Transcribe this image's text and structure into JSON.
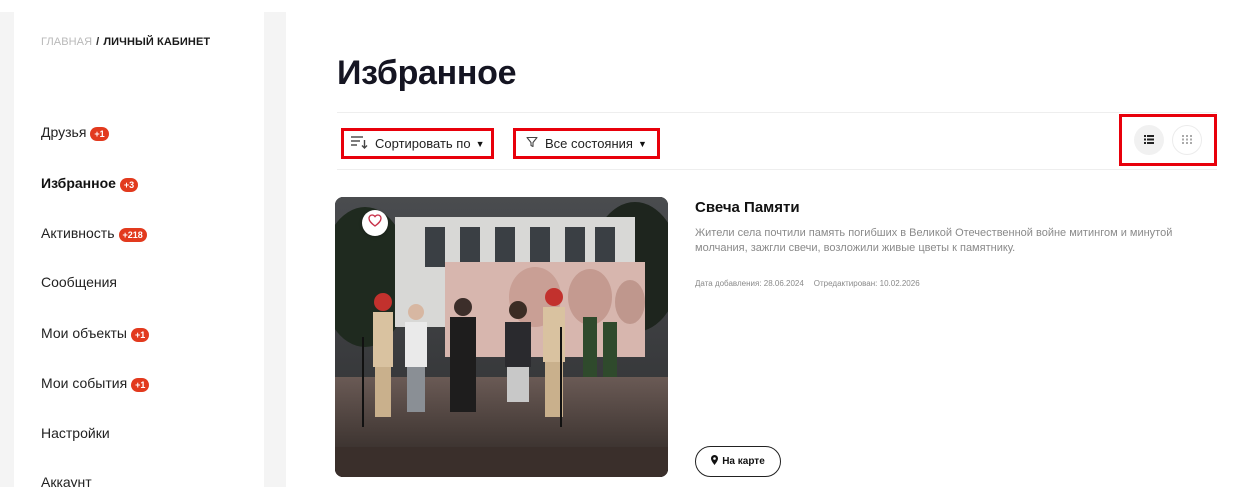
{
  "breadcrumb": {
    "home": "ГЛАВНАЯ",
    "separator": "/",
    "current": "ЛИЧНЫЙ КАБИНЕТ"
  },
  "sidebar": {
    "items": [
      {
        "label": "Друзья",
        "badge": "+1"
      },
      {
        "label": "Избранное",
        "badge": "+3",
        "active": true
      },
      {
        "label": "Активность",
        "badge": "+218"
      },
      {
        "label": "Сообщения",
        "badge": ""
      },
      {
        "label": "Мои объекты",
        "badge": "+1"
      },
      {
        "label": "Мои события",
        "badge": "+1"
      },
      {
        "label": "Настройки",
        "badge": ""
      },
      {
        "label": "Аккаунт",
        "badge": ""
      }
    ]
  },
  "page": {
    "title": "Избранное"
  },
  "toolbar": {
    "sort_label": "Сортировать по",
    "filter_label": "Все состояния",
    "view_mode": "list"
  },
  "card": {
    "title": "Свеча Памяти",
    "description": "Жители села почтили память погибших в Великой Отечественной войне митингом и минутой молчания, зажгли свечи, возложили живые цветы к памятнику.",
    "date_added": "Дата добавления: 28.06.2024",
    "date_edited": "Отредактирован: 10.02.2026",
    "map_button": "На карте"
  },
  "colors": {
    "badge": "#e23a1e",
    "highlight_box": "#e8000b",
    "title": "#151522",
    "muted_text": "#8a8a8a"
  },
  "icons": {
    "sort": "sort-icon",
    "filter": "filter-icon",
    "list_view": "list-view-icon",
    "grid_view": "grid-view-icon",
    "favorite": "heart-icon",
    "map_pin": "map-pin-icon"
  }
}
